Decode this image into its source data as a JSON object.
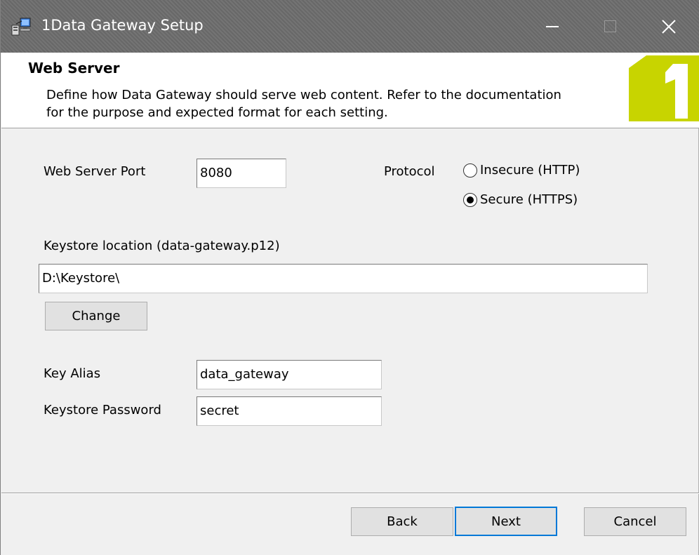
{
  "window": {
    "title": "1Data Gateway Setup",
    "icon": "setup-installer-icon"
  },
  "header": {
    "title": "Web Server",
    "description": "Define how Data Gateway should serve web content. Refer to the documentation for the purpose and expected format for each setting.",
    "logo_text": "1",
    "logo_color": "#c8d400"
  },
  "form": {
    "port_label": "Web Server Port",
    "port_value": "8080",
    "protocol_label": "Protocol",
    "protocol_options": [
      {
        "label": "Insecure (HTTP)",
        "checked": false
      },
      {
        "label": "Secure (HTTPS)",
        "checked": true
      }
    ],
    "keystore_label": "Keystore location (data-gateway.p12)",
    "keystore_value": "D:\\Keystore\\",
    "change_label": "Change",
    "alias_label": "Key Alias",
    "alias_value": "data_gateway",
    "password_label": "Keystore Password",
    "password_value": "secret"
  },
  "footer": {
    "back_label": "Back",
    "next_label": "Next",
    "cancel_label": "Cancel"
  },
  "colors": {
    "accent": "#0078d7",
    "titlebar": "#6e6e6e"
  }
}
